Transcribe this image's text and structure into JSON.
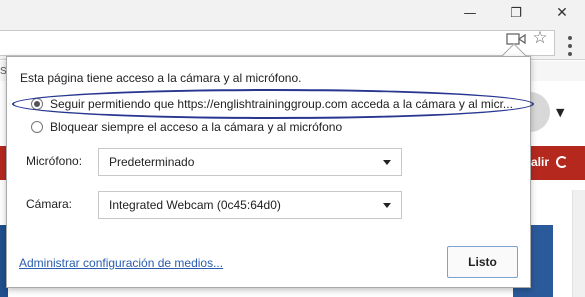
{
  "window": {
    "minimize_glyph": "—",
    "restore_glyph": "❐",
    "close_glyph": "✕"
  },
  "toolbar": {
    "camera_icon": "camera-in-use-icon",
    "star_icon": "bookmark-star-icon",
    "menu_icon": "chrome-menu-icon"
  },
  "background": {
    "edge_text": "Sh",
    "red_bar_text": "alir",
    "accent_red": "#b5281e",
    "accent_blue": "#2b5a9b"
  },
  "bubble": {
    "access_message": "Esta página tiene acceso a la cámara y al micrófono.",
    "options": [
      {
        "label": "Seguir permitiendo que https://englishtraininggroup.com acceda a la cámara y al micr...",
        "checked": true
      },
      {
        "label": "Bloquear siempre el acceso a la cámara y al micrófono",
        "checked": false
      }
    ],
    "microphone_label": "Micrófono:",
    "microphone_value": "Predeterminado",
    "camera_label": "Cámara:",
    "camera_value": "Integrated Webcam (0c45:64d0)",
    "manage_link": "Administrar configuración de medios...",
    "done_label": "Listo",
    "highlight_color": "#27368f"
  }
}
